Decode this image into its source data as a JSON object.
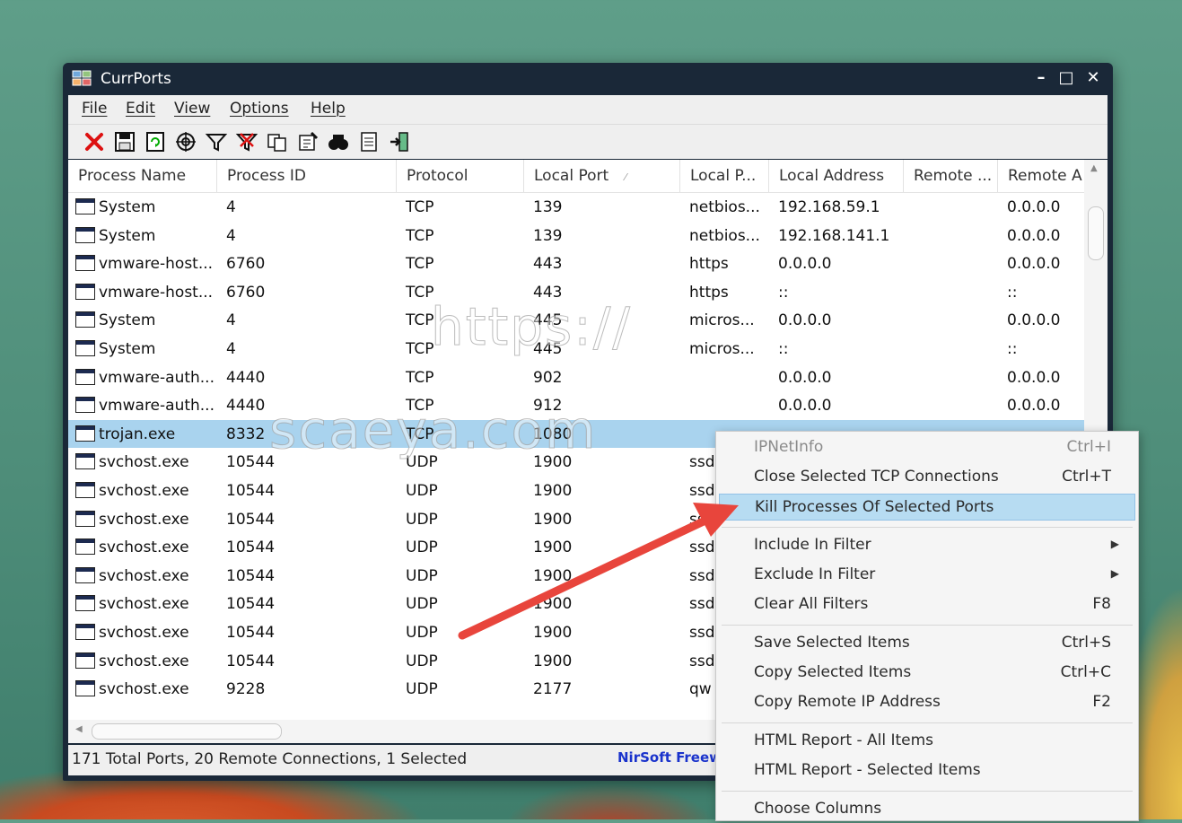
{
  "window": {
    "title": "CurrPorts"
  },
  "menu": [
    "File",
    "Edit",
    "View",
    "Options",
    "Help"
  ],
  "toolbar": [
    "close-connections-icon",
    "save-icon",
    "refresh-icon",
    "properties-target-icon",
    "filter-icon",
    "clear-filter-icon",
    "copy-icon",
    "options-icon",
    "find-icon",
    "report-icon",
    "exit-icon"
  ],
  "columns": [
    "Process Name",
    "Process ID",
    "Protocol",
    "Local Port",
    "Local P...",
    "Local Address",
    "Remote ...",
    "Remote A"
  ],
  "rows": [
    {
      "name": "System",
      "pid": "4",
      "proto": "TCP",
      "port": "139",
      "lpname": "netbios...",
      "laddr": "192.168.59.1",
      "rport": "",
      "raddr": "0.0.0.0"
    },
    {
      "name": "System",
      "pid": "4",
      "proto": "TCP",
      "port": "139",
      "lpname": "netbios...",
      "laddr": "192.168.141.1",
      "rport": "",
      "raddr": "0.0.0.0"
    },
    {
      "name": "vmware-host...",
      "pid": "6760",
      "proto": "TCP",
      "port": "443",
      "lpname": "https",
      "laddr": "0.0.0.0",
      "rport": "",
      "raddr": "0.0.0.0"
    },
    {
      "name": "vmware-host...",
      "pid": "6760",
      "proto": "TCP",
      "port": "443",
      "lpname": "https",
      "laddr": "::",
      "rport": "",
      "raddr": "::"
    },
    {
      "name": "System",
      "pid": "4",
      "proto": "TCP",
      "port": "445",
      "lpname": "micros...",
      "laddr": "0.0.0.0",
      "rport": "",
      "raddr": "0.0.0.0"
    },
    {
      "name": "System",
      "pid": "4",
      "proto": "TCP",
      "port": "445",
      "lpname": "micros...",
      "laddr": "::",
      "rport": "",
      "raddr": "::"
    },
    {
      "name": "vmware-auth...",
      "pid": "4440",
      "proto": "TCP",
      "port": "902",
      "lpname": "",
      "laddr": "0.0.0.0",
      "rport": "",
      "raddr": "0.0.0.0"
    },
    {
      "name": "vmware-auth...",
      "pid": "4440",
      "proto": "TCP",
      "port": "912",
      "lpname": "",
      "laddr": "0.0.0.0",
      "rport": "",
      "raddr": "0.0.0.0"
    },
    {
      "name": "trojan.exe",
      "pid": "8332",
      "proto": "TCP",
      "port": "1080",
      "lpname": "",
      "laddr": "",
      "rport": "",
      "raddr": ""
    },
    {
      "name": "svchost.exe",
      "pid": "10544",
      "proto": "UDP",
      "port": "1900",
      "lpname": "ssd",
      "laddr": "",
      "rport": "",
      "raddr": ""
    },
    {
      "name": "svchost.exe",
      "pid": "10544",
      "proto": "UDP",
      "port": "1900",
      "lpname": "ssd",
      "laddr": "",
      "rport": "",
      "raddr": ""
    },
    {
      "name": "svchost.exe",
      "pid": "10544",
      "proto": "UDP",
      "port": "1900",
      "lpname": "ss",
      "laddr": "",
      "rport": "",
      "raddr": ""
    },
    {
      "name": "svchost.exe",
      "pid": "10544",
      "proto": "UDP",
      "port": "1900",
      "lpname": "ssd",
      "laddr": "",
      "rport": "",
      "raddr": ""
    },
    {
      "name": "svchost.exe",
      "pid": "10544",
      "proto": "UDP",
      "port": "1900",
      "lpname": "ssd",
      "laddr": "",
      "rport": "",
      "raddr": ""
    },
    {
      "name": "svchost.exe",
      "pid": "10544",
      "proto": "UDP",
      "port": "1900",
      "lpname": "ssd",
      "laddr": "",
      "rport": "",
      "raddr": ""
    },
    {
      "name": "svchost.exe",
      "pid": "10544",
      "proto": "UDP",
      "port": "1900",
      "lpname": "ssd",
      "laddr": "",
      "rport": "",
      "raddr": ""
    },
    {
      "name": "svchost.exe",
      "pid": "10544",
      "proto": "UDP",
      "port": "1900",
      "lpname": "ssd",
      "laddr": "",
      "rport": "",
      "raddr": ""
    },
    {
      "name": "svchost.exe",
      "pid": "9228",
      "proto": "UDP",
      "port": "2177",
      "lpname": "qw",
      "laddr": "",
      "rport": "",
      "raddr": ""
    }
  ],
  "selected_row": 8,
  "status": {
    "text": "171 Total Ports, 20 Remote Connections, 1 Selected",
    "brand": "NirSoft Freew"
  },
  "context_menu": [
    {
      "label": "IPNetInfo",
      "shortcut": "Ctrl+I",
      "disabled": true
    },
    {
      "label": "Close Selected TCP Connections",
      "shortcut": "Ctrl+T"
    },
    {
      "label": "Kill Processes Of Selected Ports",
      "shortcut": "",
      "highlighted": true
    },
    {
      "sep": true
    },
    {
      "label": "Include In Filter",
      "submenu": true
    },
    {
      "label": "Exclude In Filter",
      "submenu": true
    },
    {
      "label": "Clear All Filters",
      "shortcut": "F8"
    },
    {
      "sep": true
    },
    {
      "label": "Save Selected Items",
      "shortcut": "Ctrl+S"
    },
    {
      "label": "Copy Selected Items",
      "shortcut": "Ctrl+C"
    },
    {
      "label": "Copy Remote IP Address",
      "shortcut": "F2"
    },
    {
      "sep": true
    },
    {
      "label": "HTML Report - All Items",
      "shortcut": ""
    },
    {
      "label": "HTML Report - Selected Items",
      "shortcut": ""
    },
    {
      "sep": true
    },
    {
      "label": "Choose Columns",
      "shortcut": ""
    }
  ],
  "watermark": {
    "line1": "https://",
    "line2": "scaeya.com"
  },
  "colors": {
    "selection": "#a9d3ee",
    "highlight": "#b7dcf2",
    "arrow": "#e8453c",
    "brand": "#1a33cc"
  }
}
